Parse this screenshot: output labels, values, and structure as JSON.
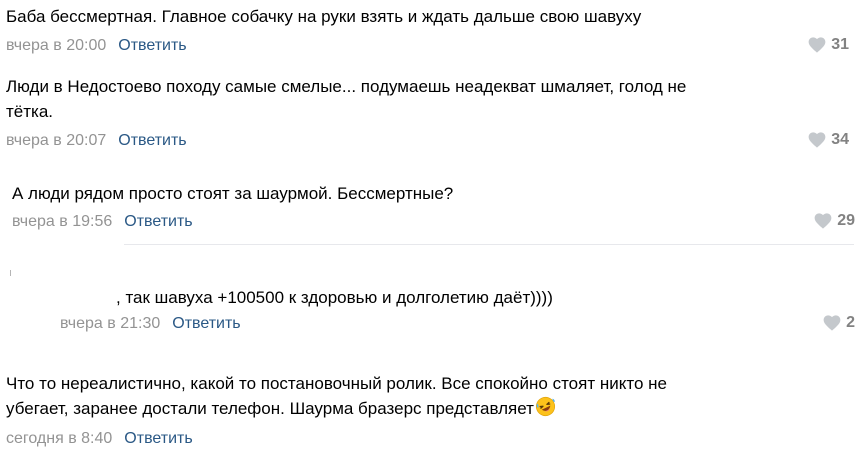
{
  "colors": {
    "date": "#939393",
    "reply_link": "#2a5885",
    "likes": "#828282",
    "divider": "#e7e8ec"
  },
  "comments": [
    {
      "text": "Баба бессмертная. Главное собачку на руки взять и ждать дальше свою шавуху",
      "date": "вчера в 20:00",
      "reply_label": "Ответить",
      "likes": "31"
    },
    {
      "text": "Люди в Недостоево походу самые смелые... подумаешь неадекват шмаляет, голод не\nтётка.",
      "date": "вчера в 20:07",
      "reply_label": "Ответить",
      "likes": "34"
    },
    {
      "text": "А люди рядом просто стоят за шаурмой. Бессмертные?",
      "date": "вчера в 19:56",
      "reply_label": "Ответить",
      "likes": "29"
    },
    {
      "text": ", так шавуха +100500 к здоровью и долголетию даёт))))",
      "date": "вчера в 21:30",
      "reply_label": "Ответить",
      "likes": "2"
    },
    {
      "text": "Что то нереалистично, какой то постановочный ролик. Все спокойно стоят никто не\nубегает, заранее достали телефон. Шаурма бразерс представляет",
      "emoji": "rolling-on-floor-laughing-emoji",
      "date": "сегодня в 8:40",
      "reply_label": "Ответить"
    }
  ]
}
